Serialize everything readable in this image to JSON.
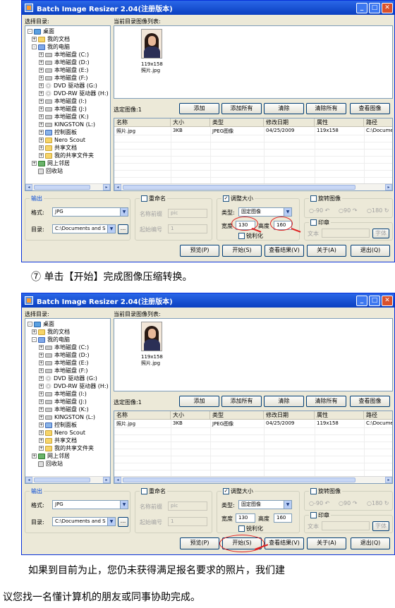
{
  "window": {
    "title": "Batch Image Resizer 2.04(注册版本)",
    "min": "_",
    "max": "□",
    "close": "✕"
  },
  "labels": {
    "select_dir": "选择目录:",
    "current_list": "当前目录图像列表:",
    "selected_images": "选定图像:1",
    "output": "输出",
    "format": "格式:",
    "directory": "目录:"
  },
  "tree": [
    {
      "label": "桌面",
      "icon": "desktop-icon"
    },
    {
      "label": "我的文档",
      "icon": "folder-icon"
    },
    {
      "label": "我的电脑",
      "icon": "computer-icon"
    },
    {
      "label": "本地磁盘 (C:)",
      "icon": "drive-icon"
    },
    {
      "label": "本地磁盘 (D:)",
      "icon": "drive-icon"
    },
    {
      "label": "本地磁盘 (E:)",
      "icon": "drive-icon"
    },
    {
      "label": "本地磁盘 (F:)",
      "icon": "drive-icon"
    },
    {
      "label": "DVD 驱动器 (G:)",
      "icon": "cd-icon"
    },
    {
      "label": "DVD-RW 驱动器 (H:)",
      "icon": "cd-icon"
    },
    {
      "label": "本地磁盘 (I:)",
      "icon": "drive-icon"
    },
    {
      "label": "本地磁盘 (J:)",
      "icon": "drive-icon"
    },
    {
      "label": "本地磁盘 (K:)",
      "icon": "drive-icon"
    },
    {
      "label": "KINGSTON (L:)",
      "icon": "drive-icon"
    },
    {
      "label": "控制面板",
      "icon": "control-panel-icon"
    },
    {
      "label": "Nero Scout",
      "icon": "folder-icon"
    },
    {
      "label": "共享文档",
      "icon": "folder-icon"
    },
    {
      "label": "我的共享文件夹",
      "icon": "folder-icon"
    },
    {
      "label": "网上邻居",
      "icon": "network-icon"
    },
    {
      "label": "回收站",
      "icon": "recycle-bin-icon"
    }
  ],
  "thumbnail": {
    "dims": "119x158",
    "name": "照片.jpg"
  },
  "buttons": {
    "add": "添加",
    "add_all": "添加所有",
    "clear": "清除",
    "clear_all": "清除所有",
    "view_image": "查看图像",
    "preview": "预览(P)",
    "start": "开始(S)",
    "view_result": "查看结果(V)",
    "about": "关于(A)",
    "exit": "退出(Q)",
    "browse": "..."
  },
  "table": {
    "headers": [
      "名称",
      "大小",
      "类型",
      "修改日期",
      "属性",
      "路径"
    ],
    "rows": [
      [
        "照片.jpg",
        "3KB",
        "JPEG图像",
        "04/25/2009",
        "119x158",
        "C:\\Documer"
      ]
    ]
  },
  "output": {
    "format_value": "JPG",
    "dir_value": "C:\\Documents and S"
  },
  "rename": {
    "title": "重命名",
    "checked": false,
    "prefix_label": "名称前缀",
    "prefix_value": "pic",
    "start_label": "起始编号",
    "start_value": "1"
  },
  "resize": {
    "title": "调整大小",
    "checked": true,
    "type_label": "类型:",
    "type_value": "固定图像",
    "width_label": "宽度",
    "width_value": "130",
    "height_label": "高度",
    "height_value": "160",
    "sharpen": "锐利化"
  },
  "rotate": {
    "title": "旋转图像",
    "opt1": "-90",
    "opt2": "90",
    "opt3": "180"
  },
  "stamp": {
    "title": "印章",
    "text_label": "文本",
    "font_btn": "字体"
  },
  "captions": {
    "step7": "⑦ 单击【开始】完成图像压缩转换。",
    "para_line1": "如果到目前为止，您仍未获得满足报名要求的照片，我们建",
    "para_line2": "议您找一名懂计算机的朋友或同事协助完成。"
  }
}
